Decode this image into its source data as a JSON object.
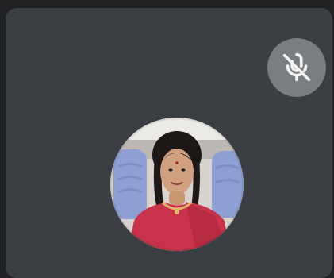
{
  "participant_tile": {
    "mic_status_icon": "mic-off-icon",
    "avatar_icon": "participant-avatar",
    "colors": {
      "tile_bg": "#3b3f43",
      "page_bg": "#1f2123",
      "mic_badge_bg": "#7a7d81",
      "mic_icon_color": "#f2f2f2"
    }
  }
}
